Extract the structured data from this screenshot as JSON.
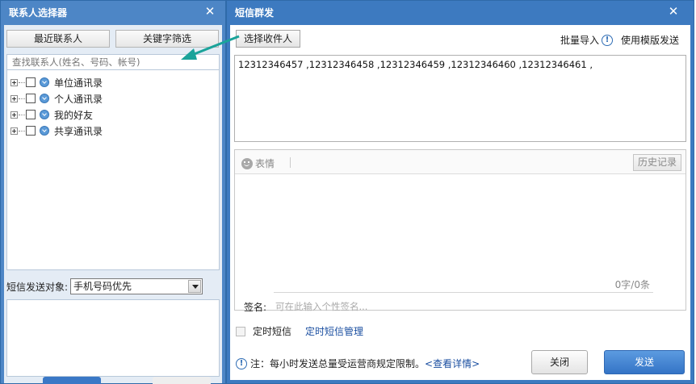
{
  "left_window": {
    "title": "联系人选择器",
    "close_glyph": "✕",
    "tabs": [
      "最近联系人",
      "关键字筛选"
    ],
    "search_placeholder": "查找联系人(姓名、号码、帐号)",
    "tree_items": [
      "单位通讯录",
      "个人通讯录",
      "我的好友",
      "共享通讯录"
    ],
    "target_label": "短信发送对象:",
    "target_value": "手机号码优先"
  },
  "right_window": {
    "title": "短信群发",
    "close_glyph": "✕",
    "pick_button": "选择收件人",
    "batch_import": "批量导入",
    "info_glyph": "!",
    "use_template": "使用模版发送",
    "recipients_text": "12312346457 ,12312346458 ,12312346459 ,12312346460 ,12312346461 ,",
    "emoji_label": "表情",
    "history_button": "历史记录",
    "counter": "0字/0条",
    "sign_label": "签名:",
    "sign_placeholder": "可在此输入个性签名...",
    "timed_sms": "定时短信",
    "timed_manage": "定时短信管理",
    "note_text": "注：每小时发送总量受运营商规定限制。",
    "note_link": "<查看详情>",
    "close_button": "关闭",
    "send_button": "发送"
  },
  "colors": {
    "accent": "#4d86c6",
    "arrow": "#1aa39a",
    "link": "#1a4ea0"
  },
  "icons": [
    "close-icon",
    "plus-icon",
    "checkbox-icon",
    "contact-group-icon",
    "info-icon",
    "smile-icon",
    "dropdown-arrow-icon",
    "annotation-arrow-icon"
  ]
}
